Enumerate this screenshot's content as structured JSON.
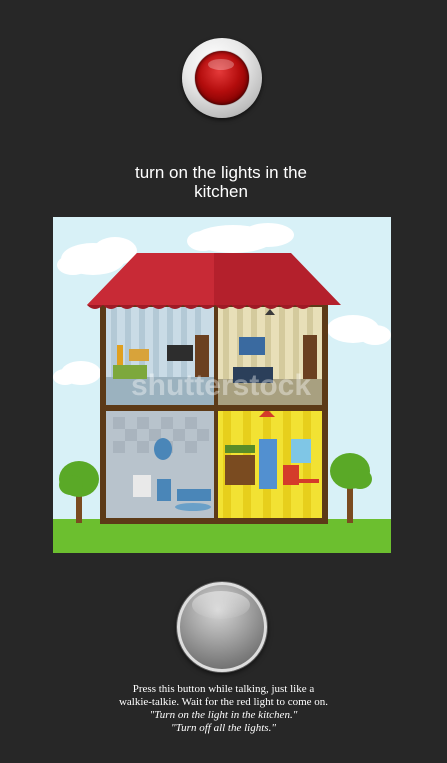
{
  "status_light": {
    "icon": "red-indicator-light",
    "color": "#b40d0d"
  },
  "prompt": {
    "line1": "turn on the lights in the",
    "line2": "kitchen"
  },
  "scene": {
    "watermark": "shutterstock",
    "kitchen_lit": true
  },
  "talk_button": {
    "icon": "push-to-talk-button"
  },
  "help": {
    "line1": "Press this button while talking, just like a",
    "line2": "walkie-talkie. Wait for the red light to come on.",
    "example1": "\"Turn on the light in the kitchen.\"",
    "example2": "\"Turn off all the lights.\""
  }
}
